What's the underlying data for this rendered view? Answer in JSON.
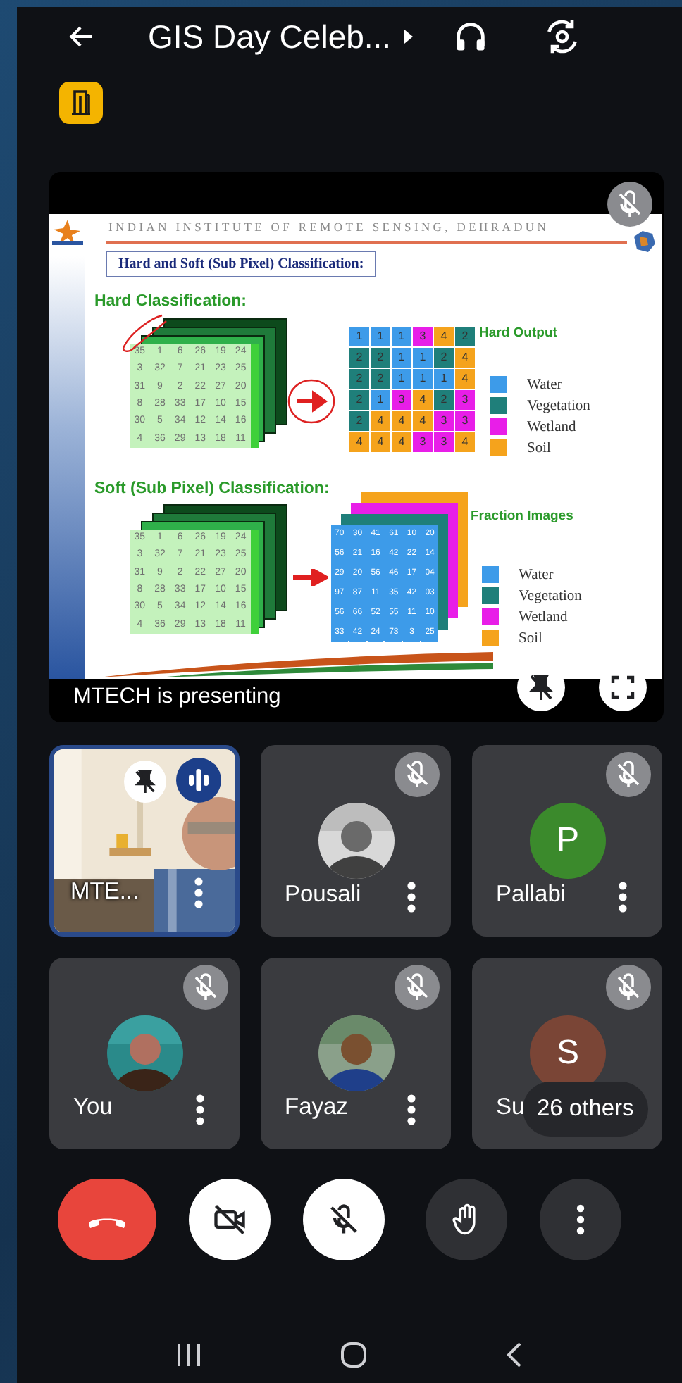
{
  "call": {
    "title": "GIS Day Celeb..."
  },
  "presentation": {
    "caption": "MTECH is presenting",
    "muted": true,
    "slide": {
      "institute": "INDIAN INSTITUTE OF REMOTE SENSING, DEHRADUN",
      "title": "Hard and Soft (Sub Pixel) Classification:",
      "hard": {
        "heading": "Hard Classification:",
        "output_label": "Hard Output",
        "input_grid": [
          [
            "35",
            "1",
            "6",
            "26",
            "19",
            "24"
          ],
          [
            "3",
            "32",
            "7",
            "21",
            "23",
            "25"
          ],
          [
            "31",
            "9",
            "2",
            "22",
            "27",
            "20"
          ],
          [
            "8",
            "28",
            "33",
            "17",
            "10",
            "15"
          ],
          [
            "30",
            "5",
            "34",
            "12",
            "14",
            "16"
          ],
          [
            "4",
            "36",
            "29",
            "13",
            "18",
            "11"
          ]
        ],
        "output_grid": [
          [
            {
              "v": "1",
              "color": "#3d9be9"
            },
            {
              "v": "1",
              "color": "#3d9be9"
            },
            {
              "v": "1",
              "color": "#3d9be9"
            },
            {
              "v": "3",
              "color": "#e81ee8"
            },
            {
              "v": "4",
              "color": "#f5a31c"
            },
            {
              "v": "2",
              "color": "#1f7f7a"
            }
          ],
          [
            {
              "v": "2",
              "color": "#1f7f7a"
            },
            {
              "v": "2",
              "color": "#1f7f7a"
            },
            {
              "v": "1",
              "color": "#3d9be9"
            },
            {
              "v": "1",
              "color": "#3d9be9"
            },
            {
              "v": "2",
              "color": "#1f7f7a"
            },
            {
              "v": "4",
              "color": "#f5a31c"
            }
          ],
          [
            {
              "v": "2",
              "color": "#1f7f7a"
            },
            {
              "v": "2",
              "color": "#1f7f7a"
            },
            {
              "v": "1",
              "color": "#3d9be9"
            },
            {
              "v": "1",
              "color": "#3d9be9"
            },
            {
              "v": "1",
              "color": "#3d9be9"
            },
            {
              "v": "4",
              "color": "#f5a31c"
            }
          ],
          [
            {
              "v": "2",
              "color": "#1f7f7a"
            },
            {
              "v": "1",
              "color": "#3d9be9"
            },
            {
              "v": "3",
              "color": "#e81ee8"
            },
            {
              "v": "4",
              "color": "#f5a31c"
            },
            {
              "v": "2",
              "color": "#1f7f7a"
            },
            {
              "v": "3",
              "color": "#e81ee8"
            }
          ],
          [
            {
              "v": "2",
              "color": "#1f7f7a"
            },
            {
              "v": "4",
              "color": "#f5a31c"
            },
            {
              "v": "4",
              "color": "#f5a31c"
            },
            {
              "v": "4",
              "color": "#f5a31c"
            },
            {
              "v": "3",
              "color": "#e81ee8"
            },
            {
              "v": "3",
              "color": "#e81ee8"
            }
          ],
          [
            {
              "v": "4",
              "color": "#f5a31c"
            },
            {
              "v": "4",
              "color": "#f5a31c"
            },
            {
              "v": "4",
              "color": "#f5a31c"
            },
            {
              "v": "3",
              "color": "#e81ee8"
            },
            {
              "v": "3",
              "color": "#e81ee8"
            },
            {
              "v": "4",
              "color": "#f5a31c"
            }
          ]
        ],
        "legend": [
          {
            "label": "Water",
            "color": "#3d9be9"
          },
          {
            "label": "Vegetation",
            "color": "#1f7f7a"
          },
          {
            "label": "Wetland",
            "color": "#e81ee8"
          },
          {
            "label": "Soil",
            "color": "#f5a31c"
          }
        ]
      },
      "soft": {
        "heading": "Soft (Sub Pixel) Classification:",
        "output_label": "Fraction Images",
        "input_grid": [
          [
            "35",
            "1",
            "6",
            "26",
            "19",
            "24"
          ],
          [
            "3",
            "32",
            "7",
            "21",
            "23",
            "25"
          ],
          [
            "31",
            "9",
            "2",
            "22",
            "27",
            "20"
          ],
          [
            "8",
            "28",
            "33",
            "17",
            "10",
            "15"
          ],
          [
            "30",
            "5",
            "34",
            "12",
            "14",
            "16"
          ],
          [
            "4",
            "36",
            "29",
            "13",
            "18",
            "11"
          ]
        ],
        "fraction_grid": [
          [
            "70",
            "30",
            "41",
            "61",
            "10",
            "20"
          ],
          [
            "56",
            "21",
            "16",
            "42",
            "22",
            "14"
          ],
          [
            "29",
            "20",
            "56",
            "46",
            "17",
            "04"
          ],
          [
            "97",
            "87",
            "11",
            "35",
            "42",
            "03"
          ],
          [
            "56",
            "66",
            "52",
            "55",
            "11",
            "10"
          ],
          [
            "33",
            "42",
            "24",
            "73",
            "3",
            "25"
          ]
        ],
        "legend": [
          {
            "label": "Water",
            "color": "#3d9be9"
          },
          {
            "label": "Vegetation",
            "color": "#1f7f7a"
          },
          {
            "label": "Wetland",
            "color": "#e81ee8"
          },
          {
            "label": "Soil",
            "color": "#f5a31c"
          }
        ]
      }
    }
  },
  "participants": [
    {
      "name": "MTE...",
      "kind": "video",
      "muted": false,
      "speaking": true,
      "pinned": true
    },
    {
      "name": "Pousali",
      "muted": true,
      "speaking": false,
      "pinned": false
    },
    {
      "name": "Pallabi",
      "kind": "initial",
      "initial": "P",
      "color": "#3b8a2c",
      "muted": true,
      "speaking": false,
      "pinned": false
    },
    {
      "name": "You",
      "muted": true,
      "speaking": false,
      "pinned": false
    },
    {
      "name": "Fayaz",
      "muted": true,
      "speaking": false,
      "pinned": false
    },
    {
      "name": "Su",
      "kind": "initial",
      "initial": "S",
      "color": "#7a4536",
      "muted": true,
      "speaking": false,
      "pinned": false,
      "others": "26 others"
    }
  ]
}
